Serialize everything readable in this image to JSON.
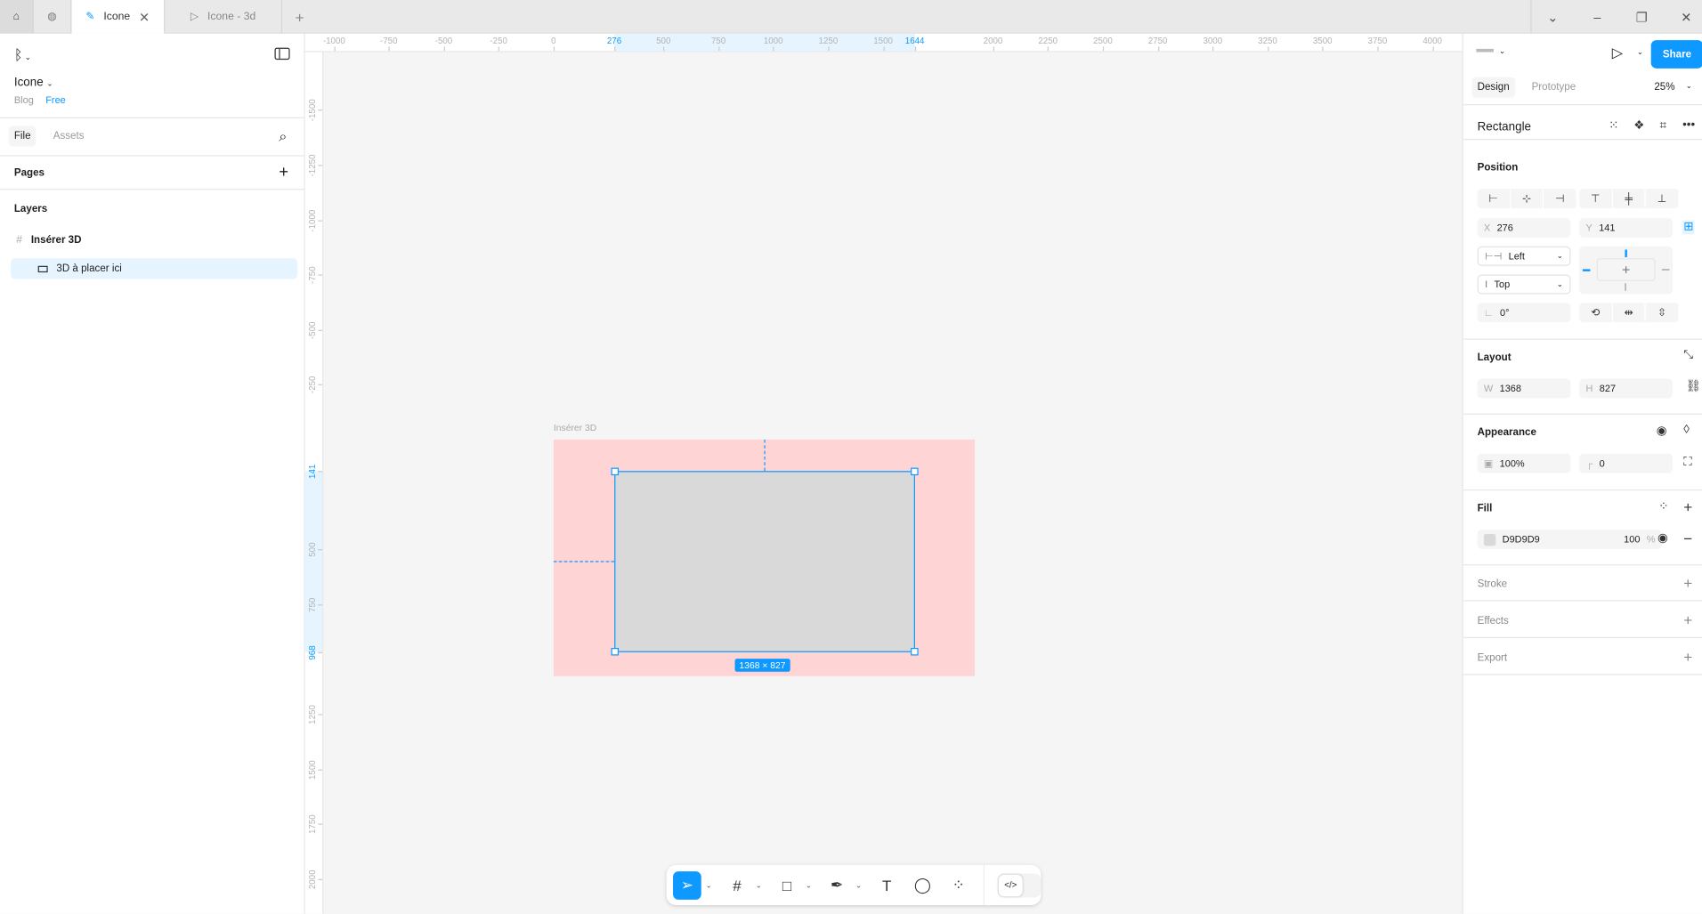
{
  "tabs": [
    {
      "label": "Icone",
      "active": true
    },
    {
      "label": "Icone - 3d",
      "active": false
    }
  ],
  "file": {
    "name": "Icone",
    "team": "Blog",
    "plan": "Free"
  },
  "left_tabs": {
    "file": "File",
    "assets": "Assets"
  },
  "pages_label": "Pages",
  "layers_label": "Layers",
  "layers": [
    {
      "name": "Insérer 3D",
      "type": "frame"
    },
    {
      "name": "3D à placer ici",
      "type": "rectangle",
      "selected": true
    }
  ],
  "ruler_h": {
    "labels": [
      "-1000",
      "-750",
      "-500",
      "-250",
      "0",
      "276",
      "500",
      "750",
      "1000",
      "1250",
      "1500",
      "1644",
      "2000",
      "2250",
      "2500",
      "2750",
      "3000",
      "3250",
      "3500",
      "3750",
      "4000"
    ],
    "selected": [
      "276",
      "1644"
    ]
  },
  "ruler_v": {
    "labels": [
      "-1500",
      "-1250",
      "-1000",
      "-750",
      "-500",
      "-250",
      "141",
      "500",
      "750",
      "968",
      "1250",
      "1500",
      "1750",
      "2000"
    ],
    "selected": [
      "141",
      "968"
    ]
  },
  "canvas": {
    "frame_label": "Insérer 3D",
    "frame_color": "#ffd4d4",
    "rect_color": "#d9d9d9",
    "selection_color": "#0d99ff",
    "size_badge": "1368 × 827"
  },
  "right": {
    "share": "Share",
    "design_tab": "Design",
    "prototype_tab": "Prototype",
    "zoom": "25%",
    "element_type": "Rectangle",
    "position": {
      "title": "Position",
      "x_label": "X",
      "x": "276",
      "y_label": "Y",
      "y": "141",
      "h_constraint": "Left",
      "v_constraint": "Top",
      "rotation": "0°"
    },
    "layout": {
      "title": "Layout",
      "w_label": "W",
      "w": "1368",
      "h_label": "H",
      "h": "827"
    },
    "appearance": {
      "title": "Appearance",
      "opacity": "100%",
      "radius": "0"
    },
    "fill": {
      "title": "Fill",
      "hex": "D9D9D9",
      "opacity": "100",
      "unit": "%"
    },
    "stroke": "Stroke",
    "effects": "Effects",
    "export": "Export"
  },
  "help": "?"
}
